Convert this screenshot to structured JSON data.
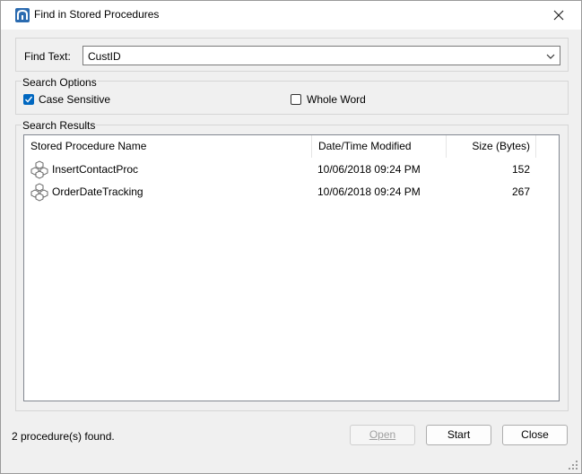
{
  "window": {
    "title": "Find in Stored Procedures"
  },
  "find": {
    "label": "Find Text:",
    "value": "CustID"
  },
  "options": {
    "legend": "Search Options",
    "case_sensitive": {
      "label": "Case Sensitive",
      "checked": true
    },
    "whole_word": {
      "label": "Whole Word",
      "checked": false
    }
  },
  "results": {
    "legend": "Search Results",
    "columns": [
      "Stored Procedure Name",
      "Date/Time Modified",
      "Size (Bytes)"
    ],
    "rows": [
      {
        "name": "InsertContactProc",
        "modified": "10/06/2018 09:24 PM",
        "size": "152",
        "icon": "stored-procedure-icon"
      },
      {
        "name": "OrderDateTracking",
        "modified": "10/06/2018 09:24 PM",
        "size": "267",
        "icon": "stored-procedure-icon"
      }
    ]
  },
  "status": "2 procedure(s) found.",
  "buttons": {
    "open": "Open",
    "start": "Start",
    "close": "Close"
  },
  "colors": {
    "accent": "#0067c0",
    "window_bg": "#f0f0f0"
  }
}
